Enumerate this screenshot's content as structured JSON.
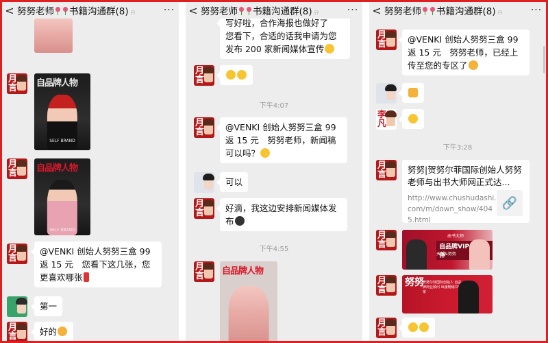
{
  "chat": {
    "title_prefix": "努努老师",
    "title_suffix": "书籍沟通群(8)",
    "more_label": "···",
    "back_label": "<"
  },
  "panel1": {
    "msg_venki": "@VENKI 创始人努努三盒 99 返 15 元　您看下这几张，您更喜欢哪张",
    "msg_first": "第一",
    "msg_ok": "好的",
    "cover_mast": "自品牌人物",
    "cover_sub": "SELF BRAND"
  },
  "panel2": {
    "msg_top": "写好啦，合作海报也做好了　您看下，合适的话我申请为您发布 200 家新闻媒体宣传",
    "time1": "下午4:07",
    "msg_venki": "@VENKI 创始人努努三盒 99 返 15 元　努努老师，新闻稿可以吗？",
    "msg_keyi": "可以",
    "msg_arrange": "好滴，我这边安排新闻媒体发布",
    "time2": "下午4:55",
    "cover_mast": "自品牌人物"
  },
  "panel3": {
    "msg_venki": "@VENKI 创始人努努三盒 99 返 15 元　努努老师，已经上传至您的专区了",
    "time1": "下午3:28",
    "link_title": "努努|贺努尔菲国际创始人努努老师与出书大师网正式达...",
    "link_url": "http://www.chushudashi.com/m/down_show/4045.html",
    "banner_text": "自品牌VIP合作伙伴",
    "banner_top": "出书大师",
    "banner_sub": "天城&努努",
    "banner2_big": "努努",
    "banner2_lines": "贺努尔菲国际创始人 自品牌商业顾问 出版畅销书作家"
  },
  "colors": {
    "border": "#e02020",
    "background": "#ededed",
    "bubble": "#ffffff",
    "avatar": "#b41818"
  }
}
